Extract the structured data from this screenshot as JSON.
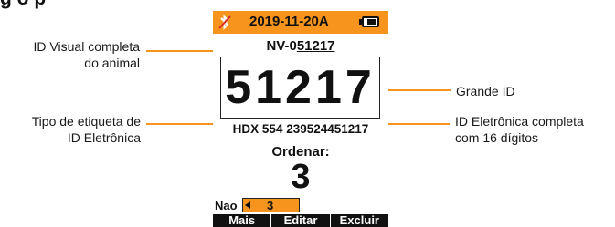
{
  "page": {
    "heading": "g       o      p"
  },
  "callouts": {
    "visual_id": [
      "ID Visual completa",
      "do animal"
    ],
    "tag_type": [
      "Tipo de etiqueta de",
      "ID Eletrônica"
    ],
    "big_id": [
      "Grande ID"
    ],
    "eid_full": [
      "ID Eletrônica completa",
      "com 16 dígitos"
    ]
  },
  "colors": {
    "accent": "#f7941d",
    "text": "#111111",
    "softkey_bar": "#111111"
  },
  "device": {
    "header": {
      "bluetooth_icon": "bluetooth-off-icon",
      "title": "2019-11-20A",
      "battery_icon": "battery-icon"
    },
    "visual_id": {
      "prefix": "NV-0",
      "underlined": "51217"
    },
    "big_id": "51217",
    "eid": "HDX 554 239524451217",
    "order": {
      "label": "Ordenar:",
      "value": "3"
    },
    "field": {
      "label": "Nao",
      "icon": "arrow-left-icon",
      "value": "3"
    },
    "softkeys": [
      "Mais",
      "Editar",
      "Excluir"
    ]
  }
}
